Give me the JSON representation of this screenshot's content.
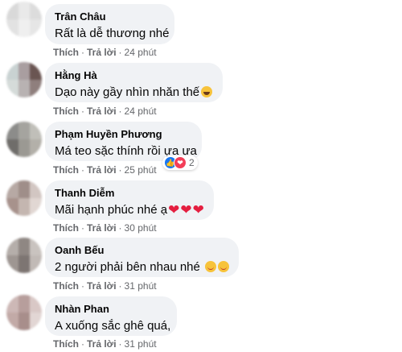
{
  "labels": {
    "like": "Thích",
    "reply": "Trả lời",
    "separator": "·"
  },
  "comments": [
    {
      "name": "Trân Châu",
      "text": "Rất là dễ thương nhé",
      "time": "24 phút",
      "emojis": "",
      "avatar_colors": [
        "#d9d9d9",
        "#e9e9e9",
        "#dcdcdc",
        "#e2e2e2",
        "#efefef",
        "#e6e6e6"
      ]
    },
    {
      "name": "Hằng Hà",
      "text": "Dạo này gầy nhìn nhăn thế",
      "time": "24 phút",
      "emojis": "rolling-on-floor-laughing",
      "avatar_colors": [
        "#c9d2d2",
        "#a99ea0",
        "#6a5552",
        "#d5dbd9",
        "#b8b2b2",
        "#8f7f7d"
      ]
    },
    {
      "name": "Phạm Huyền Phương",
      "text": "Má teo sặc thính rồi ựa ựa",
      "time": "25 phút",
      "reaction_count": "2",
      "avatar_colors": [
        "#8c8c8a",
        "#a5a49f",
        "#c0bfb9",
        "#6f6d6a",
        "#9b9993",
        "#b3b0a9"
      ]
    },
    {
      "name": "Thanh Diễm",
      "text": "Mãi hạnh phúc nhé ạ",
      "time": "30 phút",
      "emojis": "hearts",
      "avatar_colors": [
        "#b7a9a4",
        "#9f8e89",
        "#d2c6c2",
        "#a7928c",
        "#c4b6b0",
        "#e1d7d3"
      ]
    },
    {
      "name": "Oanh Bếu",
      "text": "2 người phải bên nhau nhé",
      "time": "31 phút",
      "emojis": "smiling-faces",
      "avatar_colors": [
        "#b5aeaa",
        "#8f8783",
        "#c9c3bf",
        "#9e9692",
        "#7d7572",
        "#c1bab6"
      ]
    },
    {
      "name": "Nhàn Phan",
      "text": "A xuống sắc ghê quá,",
      "time": "31 phút",
      "emojis": "",
      "avatar_colors": [
        "#cdb8b6",
        "#b79e9c",
        "#d9c8c6",
        "#c2aaa7",
        "#a88e8b",
        "#e2d6d4"
      ]
    }
  ]
}
